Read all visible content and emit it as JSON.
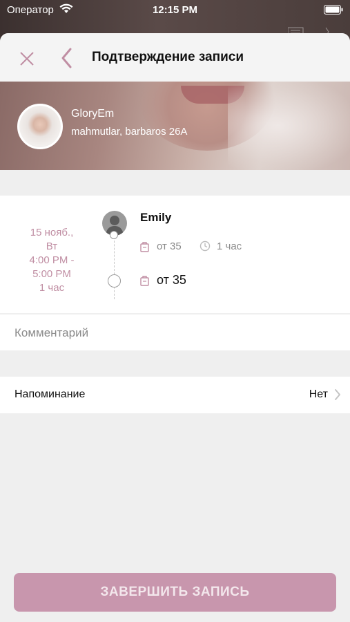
{
  "status_bar": {
    "carrier": "Оператор",
    "time": "12:15 PM"
  },
  "header": {
    "title": "Подтверждение записи",
    "accent_color": "#c08ea3"
  },
  "salon": {
    "name": "GloryEm",
    "address": "mahmutlar, barbaros 26A"
  },
  "appointment": {
    "date_line_1": "15 нояб.,",
    "date_line_2": "Вт",
    "time_start": "4:00 PM -",
    "time_end": "5:00 PM",
    "duration": "1 час",
    "master_name": "Emily",
    "master_price": "от 35",
    "master_duration": "1 час",
    "total_price": "от 35"
  },
  "comment": {
    "placeholder": "Комментарий"
  },
  "reminder": {
    "label": "Напоминание",
    "value": "Нет"
  },
  "actions": {
    "finish_label": "ЗАВЕРШИТЬ ЗАПИСЬ",
    "button_color": "#c896ad"
  }
}
